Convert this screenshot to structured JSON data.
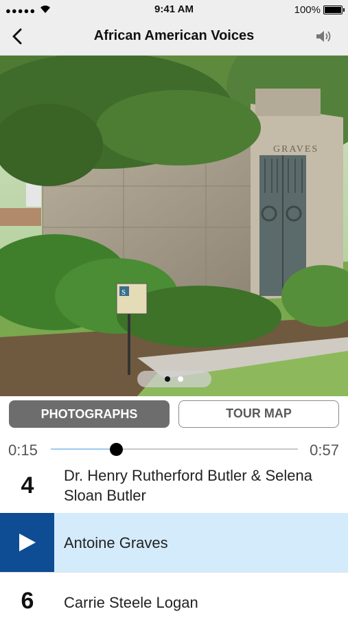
{
  "status_bar": {
    "signal": "●●●●●",
    "time": "9:41 AM",
    "battery": "100%"
  },
  "nav": {
    "title": "African American Voices",
    "back_icon": "chevron-left-icon",
    "speaker_icon": "speaker-icon"
  },
  "photo": {
    "description_icon": "tour-photo",
    "inscription": "GRAVES",
    "sign_letter": "S",
    "pager": {
      "count": 2,
      "active_index": 0
    }
  },
  "segments": {
    "photographs": "PHOTOGRAPHS",
    "tour_map": "TOUR MAP",
    "active": "photographs"
  },
  "player": {
    "elapsed": "0:15",
    "duration": "0:57",
    "progress": 0.263
  },
  "stops": [
    {
      "number": "4",
      "name": "Dr. Henry Rutherford Butler & Selena Sloan Butler",
      "playing": false
    },
    {
      "number": "",
      "name": "Antoine Graves",
      "playing": true
    },
    {
      "number": "6",
      "name": "Carrie Steele Logan",
      "playing": false
    }
  ],
  "colors": {
    "accent_dark_blue": "#0e4c94",
    "selected_row": "#d4ebfc",
    "segment_active": "#6d6d6d",
    "progress_played": "#9ccaf0"
  }
}
